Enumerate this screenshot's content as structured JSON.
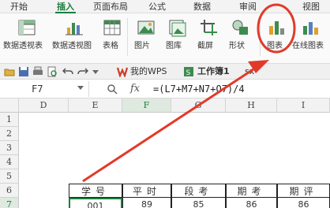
{
  "ribbon_tabs": [
    "开始",
    "插入",
    "页面布局",
    "公式",
    "数据",
    "审阅",
    "视图"
  ],
  "active_tab": "插入",
  "ribbon_buttons": [
    "数据透视表",
    "数据透视图",
    "表格",
    "图片",
    "图库",
    "截屏",
    "形状",
    "图表",
    "在线图表"
  ],
  "quick_access": {
    "icons": [
      "open-folder-icon",
      "save-icon",
      "print-icon",
      "print-preview-icon",
      "undo-icon",
      "redo-icon",
      "dropdown-icon"
    ],
    "doc_tabs": [
      {
        "label": "我的WPS"
      },
      {
        "label": "工作簿1"
      },
      {
        "label": "sx"
      }
    ]
  },
  "formula_bar": {
    "name_box": "F7",
    "fx": "fx",
    "formula": "=(L7+M7+N7+O7)/4"
  },
  "columns": [
    "D",
    "E",
    "F",
    "G",
    "H",
    "I"
  ],
  "rows": [
    "1",
    "2",
    "3",
    "4",
    "5",
    "6",
    "7"
  ],
  "row6_headers": [
    "学号",
    "平时",
    "段考",
    "期考",
    "期评"
  ],
  "row7_values": [
    "001",
    "89",
    "85",
    "86",
    "86"
  ],
  "colors": {
    "accent": "#1c7d3e",
    "annotation": "#e23a2a"
  }
}
